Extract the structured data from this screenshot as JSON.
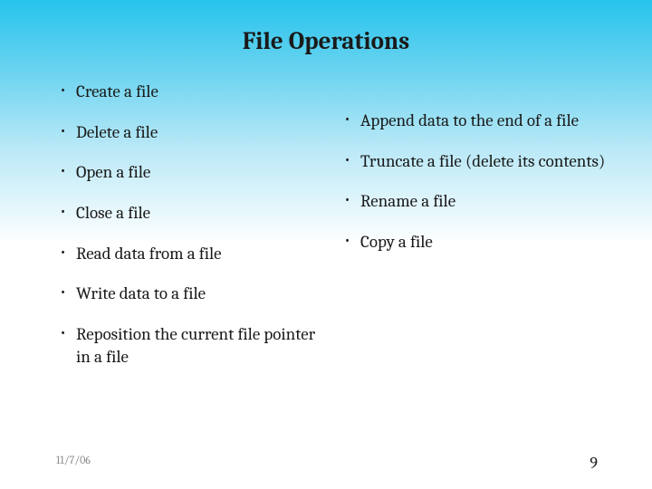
{
  "title": "File Operations",
  "left_items": [
    "Create a file",
    "Delete a file",
    "Open a file",
    "Close a file",
    "Read data from a file",
    "Write data to a file",
    "Reposition the current file pointer in a file"
  ],
  "right_items": [
    "Append data to the end of a file",
    "Truncate a file (delete its contents)",
    "Rename a file",
    "Copy a file"
  ],
  "footer": {
    "date": "11/7/06",
    "page": "9"
  }
}
